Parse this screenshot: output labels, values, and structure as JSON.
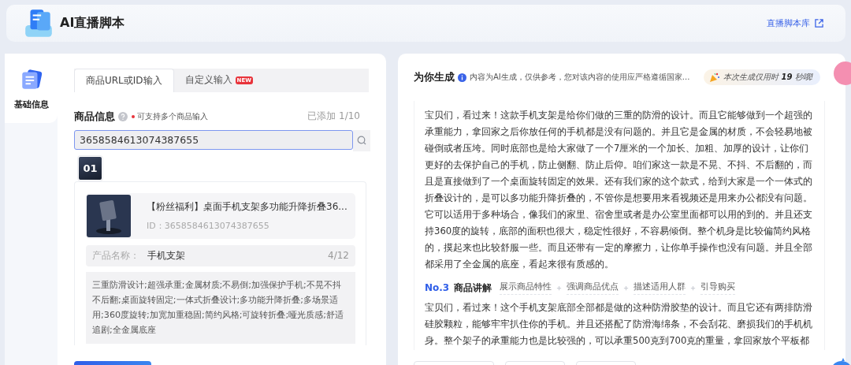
{
  "header": {
    "title": "AI直播脚本",
    "link": "直播脚本库"
  },
  "sidebar": {
    "items": [
      {
        "label": "基础信息",
        "selected": true
      }
    ]
  },
  "tabs": [
    {
      "label": "商品URL或ID输入",
      "selected": true
    },
    {
      "label": "自定义输入",
      "selected": false,
      "badge": "NEW"
    }
  ],
  "product_info": {
    "label": "商品信息",
    "hint": "可支持多个商品输入",
    "count": "已添加 1/10",
    "input_value": "3658584613074387655",
    "thumb_tabs": [
      {
        "label": "01",
        "selected": true
      }
    ],
    "product": {
      "title": "【粉丝福利】桌面手机支架多功能升降折叠36...",
      "id": "ID：3658584613074387655"
    },
    "name_row": {
      "label": "产品名称：",
      "value": "手机支架",
      "count": "4/12"
    },
    "features": "三重防滑设计;超强承重;金属材质;不易倒;加强保护手机;不晃不抖不后翻;桌面旋转固定;一体式折叠设计;多功能升降折叠;多场景适用;360度旋转;加宽加重稳固;简约风格;可旋转折叠;哑光质感;舒适追剧;全金属底座"
  },
  "result": {
    "title": "为你生成",
    "disclaimer": "内容为AI生成，仅供参考，您对该内容的使用应严格遵循国家...",
    "timing": "本次生成仅用时 **19** 秒哦!",
    "paragraphs": [
      "宝贝们，看过来！这款手机支架是给你们做的三重的防滑的设计。而且它能够做到一个超强的承重能力，拿回家之后你放任何的手机都是没有问题的。并且它是金属的材质，不会轻易地被碰倒或者压垮。同时底部也是给大家做了一个7厘米的一个加长、加粗、加厚的设计，让你们更好的去保护自己的手机，防止侧翻、防止后仰。咱们家这一款是不晃、不抖、不后翻的，而且是直接做到了一个桌面旋转固定的效果。还有我们家的这个款式，给到大家是一个一体式的折叠设计的，是可以多功能升降折叠的，不管你是想要用来看视频还是用来办公都没有问题。它可以适用于多种场合，像我们的家里、宿舍里或者是办公室里面都可以用的到的。并且还支持360度的旋转，底部的面积也很大，稳定性很好，不容易倾倒。整个机身是比较偏简约风格的，摸起来也比较舒服一些。而且还带有一定的摩擦力，让你单手操作也没有问题。并且全部都采用了全金属的底座，看起来很有质感的。"
    ],
    "section": {
      "number": "No.3",
      "title": "商品讲解",
      "steps": [
        "展示商品特性",
        "强调商品优点",
        "描述适用人群",
        "引导购买"
      ]
    },
    "section_paragraphs": [
      "宝贝们，看过来！这个手机支架底部全部都是做的这种防滑胶垫的设计。而且它还有两排防滑硅胶颗粒，能够牢牢扒住你的手机。并且还搭配了防滑海绵条，不会刮花、磨损我们的手机机身。整个架子的承重能力也是比较强的，可以承重500克到700克的重量，拿回家放个平板都"
    ]
  }
}
